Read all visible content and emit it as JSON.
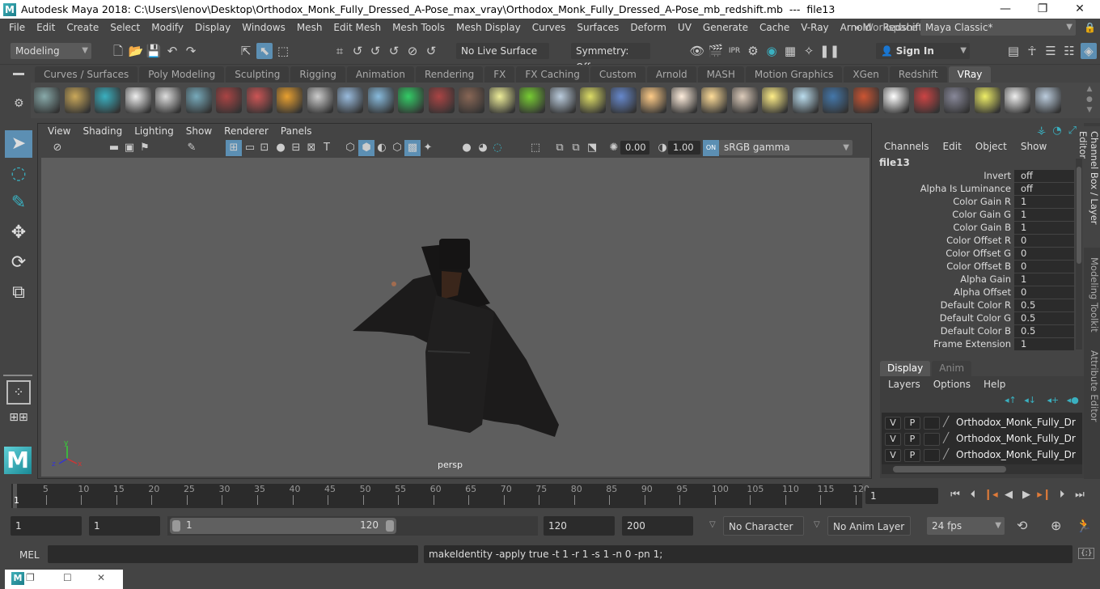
{
  "titlebar": {
    "title": "Autodesk Maya 2018: C:\\Users\\lenov\\Desktop\\Orthodox_Monk_Fully_Dressed_A-Pose_max_vray\\Orthodox_Monk_Fully_Dressed_A-Pose_mb_redshift.mb  ---  file13",
    "minimize": "—",
    "maximize": "❐",
    "close": "✕"
  },
  "menubar": {
    "items": [
      "File",
      "Edit",
      "Create",
      "Select",
      "Modify",
      "Display",
      "Windows",
      "Mesh",
      "Edit Mesh",
      "Mesh Tools",
      "Mesh Display",
      "Curves",
      "Surfaces",
      "Deform",
      "UV",
      "Generate",
      "Cache",
      "V-Ray",
      "Arnold",
      "Redshift"
    ],
    "more": "»",
    "workspace_label": "Workspace :",
    "workspace_value": "Maya Classic*"
  },
  "statusline": {
    "menuset": "Modeling",
    "live_surface": "No Live Surface",
    "symmetry": "Symmetry: Off",
    "sign_in": "Sign In"
  },
  "shelf": {
    "tabs": [
      "Curves / Surfaces",
      "Poly Modeling",
      "Sculpting",
      "Rigging",
      "Animation",
      "Rendering",
      "FX",
      "FX Caching",
      "Custom",
      "Arnold",
      "MASH",
      "Motion Graphics",
      "XGen",
      "Redshift",
      "VRay"
    ],
    "active_tab": "VRay",
    "icons": [
      "export-scene-icon",
      "import-folder-icon",
      "object-properties-icon",
      "vray-logo-icon",
      "vray-log-icon",
      "vray-material-icon",
      "camera-icon",
      "material-spheres-icon",
      "fire-icon",
      "displacement-icon",
      "proxy-icon",
      "cone-sphere-icon",
      "light-cone-icon",
      "fur-icon",
      "texture-tile-icon",
      "sphere-light-icon",
      "grass-icon",
      "particles-icon",
      "curve-icon",
      "globe-icon",
      "dome-light-icon",
      "spot-light-icon",
      "sphere-glow-icon",
      "ies-light-icon",
      "sun-icon",
      "plane-icon",
      "blue-sphere-icon",
      "stripe-sphere-icon",
      "checker-icon",
      "frame-buffer-icon",
      "settings-panel-icon",
      "light-lister-icon",
      "cloud-icon",
      "help-icon"
    ]
  },
  "viewport": {
    "menus": [
      "View",
      "Shading",
      "Lighting",
      "Show",
      "Renderer",
      "Panels"
    ],
    "exposure": "0.00",
    "gamma": "1.00",
    "color_space": "sRGB gamma",
    "camera": "persp",
    "axis": {
      "x": "x",
      "y": "y",
      "z": "z"
    }
  },
  "channelbox": {
    "menus": [
      "Channels",
      "Edit",
      "Object",
      "Show"
    ],
    "node": "file13",
    "attributes": [
      {
        "name": "Invert",
        "value": "off"
      },
      {
        "name": "Alpha Is Luminance",
        "value": "off"
      },
      {
        "name": "Color Gain R",
        "value": "1"
      },
      {
        "name": "Color Gain G",
        "value": "1"
      },
      {
        "name": "Color Gain B",
        "value": "1"
      },
      {
        "name": "Color Offset R",
        "value": "0"
      },
      {
        "name": "Color Offset G",
        "value": "0"
      },
      {
        "name": "Color Offset B",
        "value": "0"
      },
      {
        "name": "Alpha Gain",
        "value": "1"
      },
      {
        "name": "Alpha Offset",
        "value": "0"
      },
      {
        "name": "Default Color R",
        "value": "0.5"
      },
      {
        "name": "Default Color G",
        "value": "0.5"
      },
      {
        "name": "Default Color B",
        "value": "0.5"
      },
      {
        "name": "Frame Extension",
        "value": "1"
      }
    ]
  },
  "layereditor": {
    "tabs": [
      "Display",
      "Anim"
    ],
    "active_tab": "Display",
    "menus": [
      "Layers",
      "Options",
      "Help"
    ],
    "layers": [
      {
        "v": "V",
        "p": "P",
        "name": "Orthodox_Monk_Fully_Dres"
      },
      {
        "v": "V",
        "p": "P",
        "name": "Orthodox_Monk_Fully_Dres"
      },
      {
        "v": "V",
        "p": "P",
        "name": "Orthodox_Monk_Fully_Dres"
      }
    ]
  },
  "side_tabs": [
    "Channel Box / Layer Editor",
    "Modeling Toolkit",
    "Attribute Editor"
  ],
  "timeline": {
    "ticks": [
      "5",
      "10",
      "15",
      "20",
      "25",
      "30",
      "35",
      "40",
      "45",
      "50",
      "55",
      "60",
      "65",
      "70",
      "75",
      "80",
      "85",
      "90",
      "95",
      "100",
      "105",
      "110",
      "115",
      "120"
    ],
    "current_frame_marker": "1",
    "current_frame": "1",
    "start": 1,
    "end": 120
  },
  "range": {
    "anim_start": "1",
    "playback_start": "1",
    "slider_start": "1",
    "slider_end": "120",
    "playback_end": "120",
    "anim_end": "200",
    "character_set": "No Character Set",
    "anim_layer": "No Anim Layer",
    "fps": "24 fps"
  },
  "command": {
    "language": "MEL",
    "input": "",
    "result": "makeIdentity -apply true -t 1 -r 1 -s 1 -n 0 -pn 1;"
  },
  "colors": {
    "accent": "#5c8fb3",
    "key_marker": "#e07b39",
    "viewport_bg": "#5e5e5e"
  }
}
